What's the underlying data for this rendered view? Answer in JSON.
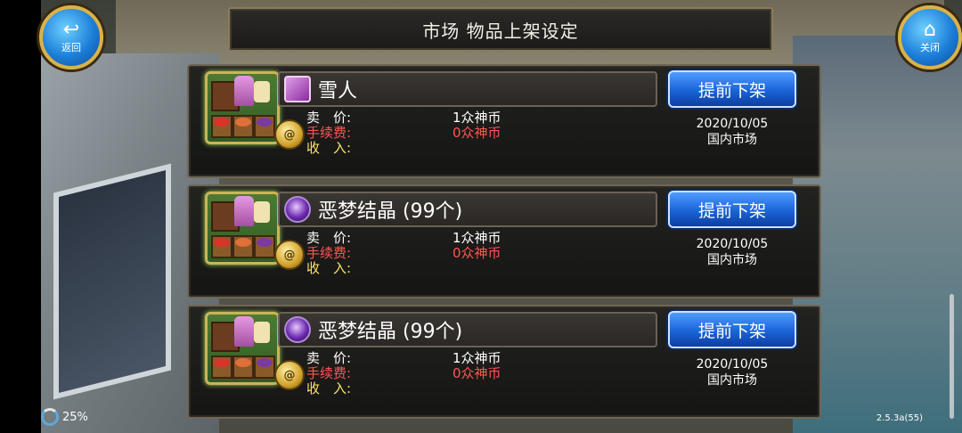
{
  "header": {
    "title": "市场 物品上架设定"
  },
  "buttons": {
    "back_label": "返回",
    "close_label": "关闭"
  },
  "listings": [
    {
      "item_name": "雪人",
      "item_icon": "gift-box-icon",
      "delist_label": "提前下架",
      "price_label": "卖　价:",
      "fee_label": "手续费:",
      "income_label": "收　入:",
      "price_value": "1众神币",
      "fee_value": "0众神币",
      "date": "2020/10/05",
      "market": "国内市场"
    },
    {
      "item_name": "恶梦结晶 (99个)",
      "item_icon": "purple-orb-icon",
      "delist_label": "提前下架",
      "price_label": "卖　价:",
      "fee_label": "手续费:",
      "income_label": "收　入:",
      "price_value": "1众神币",
      "fee_value": "0众神币",
      "date": "2020/10/05",
      "market": "国内市场"
    },
    {
      "item_name": "恶梦结晶 (99个)",
      "item_icon": "purple-orb-icon",
      "delist_label": "提前下架",
      "price_label": "卖　价:",
      "fee_label": "手续费:",
      "income_label": "收　入:",
      "price_value": "1众神币",
      "fee_value": "0众神币",
      "date": "2020/10/05",
      "market": "国内市场"
    }
  ],
  "status": {
    "battery": "25%",
    "version": "2.5.3a(55)"
  },
  "colors": {
    "accent_blue": "#1a63d8",
    "fee_red": "#ff5555",
    "income_yellow": "#ffe46a",
    "frame_gold": "#d9b24b"
  }
}
